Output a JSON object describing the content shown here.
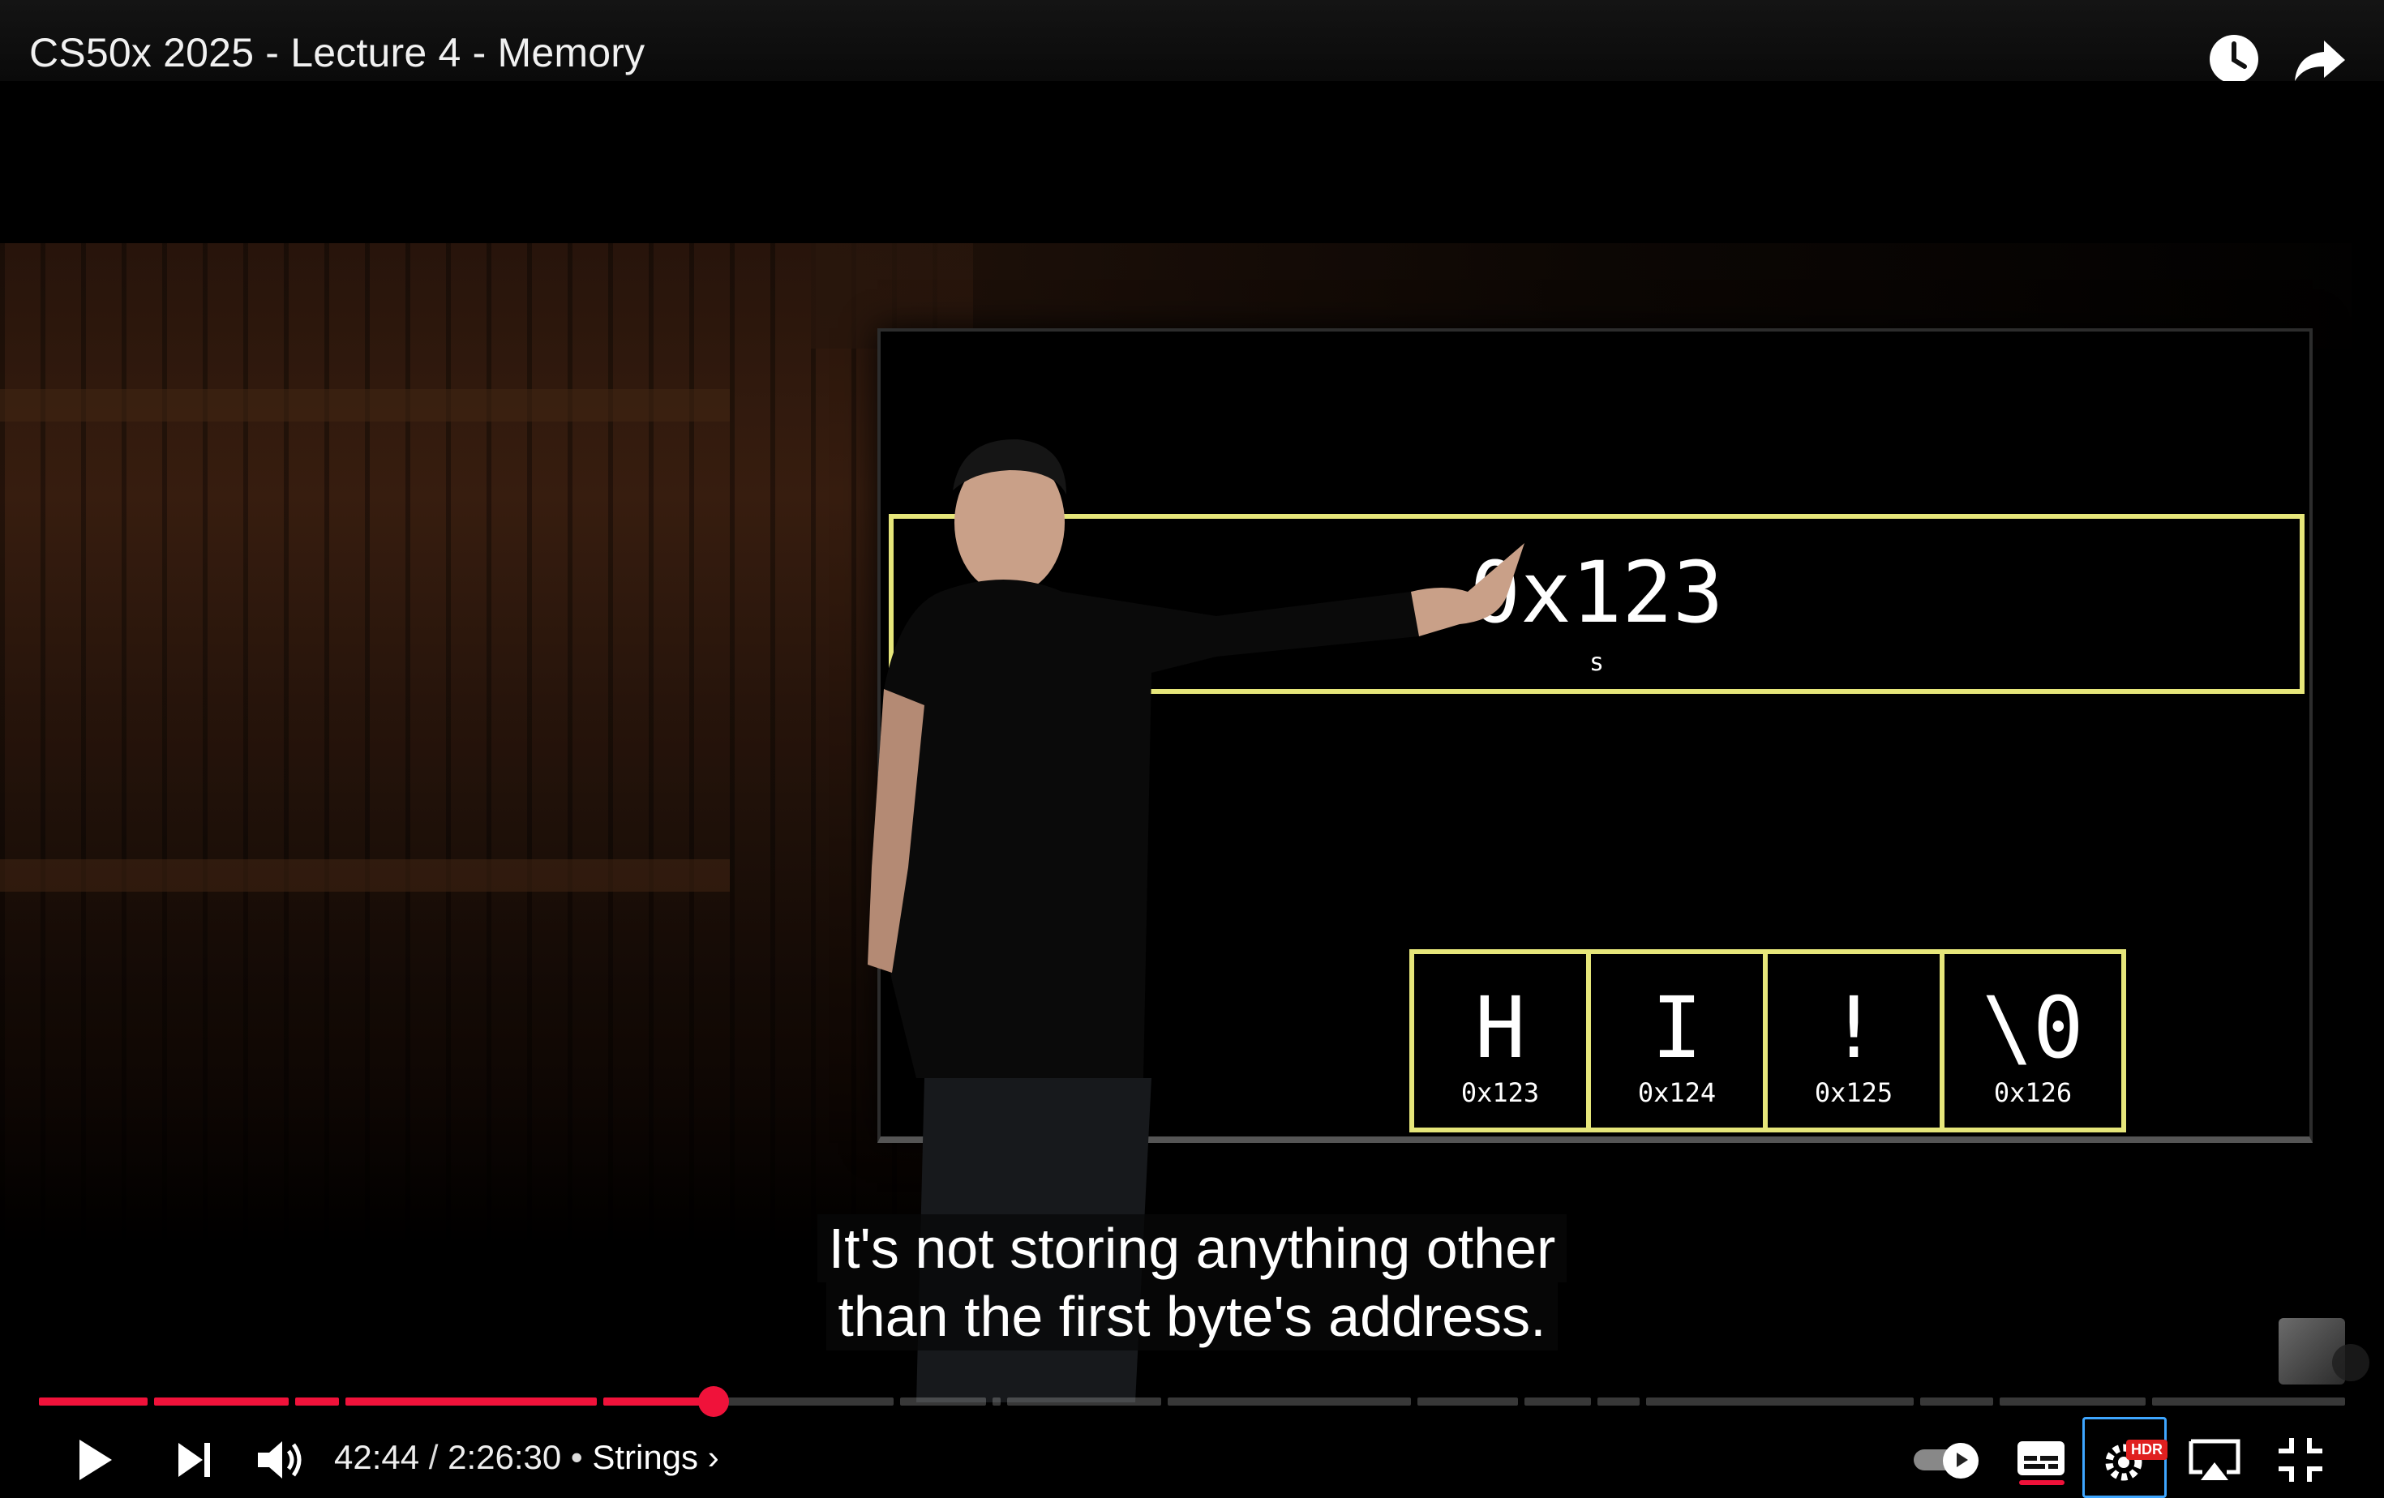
{
  "video": {
    "title": "CS50x 2025 - Lecture 4 - Memory"
  },
  "top_actions": {
    "watch_later_icon": "clock-icon",
    "share_icon": "share-icon"
  },
  "slide": {
    "pointer_value": "0x123",
    "pointer_name": "s",
    "cells": [
      {
        "char": "H",
        "address": "0x123"
      },
      {
        "char": "I",
        "address": "0x124"
      },
      {
        "char": "!",
        "address": "0x125"
      },
      {
        "char": "\\0",
        "address": "0x126"
      }
    ]
  },
  "captions": {
    "line1": "It's not storing anything other",
    "line2": "than the first byte's address."
  },
  "progress": {
    "played_fraction": 0.2897,
    "played_color": "#f0123a"
  },
  "controls": {
    "current_time": "42:44",
    "separator": " / ",
    "duration": "2:26:30",
    "chapter_separator": " • ",
    "chapter": "Strings",
    "chapter_chevron": "›",
    "icons": [
      "play-icon",
      "next-icon",
      "volume-icon",
      "autoplay-toggle",
      "subtitles-icon",
      "settings-icon",
      "airplay-icon",
      "exit-fullscreen-icon"
    ],
    "hdr_label": "HDR"
  }
}
